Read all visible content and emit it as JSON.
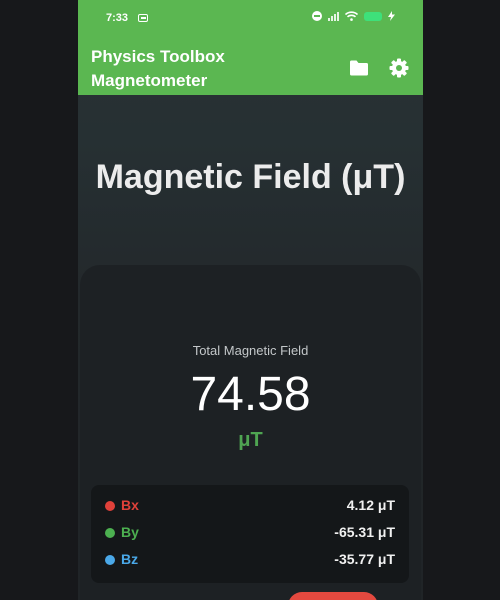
{
  "status_bar": {
    "time": "7:33"
  },
  "header": {
    "title_line1": "Physics Toolbox",
    "title_line2": "Magnetometer",
    "color": "#5bb751"
  },
  "page": {
    "title": "Magnetic Field (μT)"
  },
  "total": {
    "label": "Total Magnetic Field",
    "value": "74.58",
    "unit": "μT",
    "unit_color": "#4fa552"
  },
  "components": [
    {
      "name": "Bx",
      "value": "4.12 μT",
      "color": "#e0413a"
    },
    {
      "name": "By",
      "value": "-65.31 μT",
      "color": "#4cb050"
    },
    {
      "name": "Bz",
      "value": "-35.77 μT",
      "color": "#4aa8e8"
    }
  ],
  "icons": {
    "folder": "folder-icon",
    "settings": "gear-icon"
  }
}
